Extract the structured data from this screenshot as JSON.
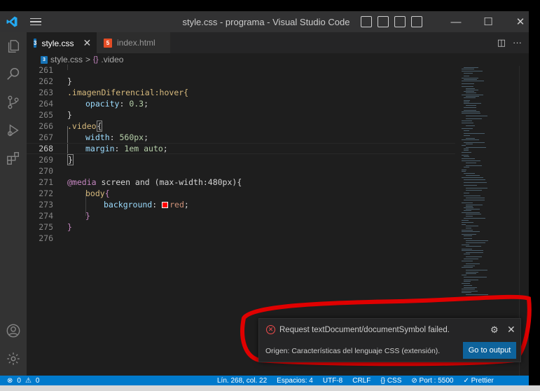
{
  "window": {
    "title": "style.css - programa - Visual Studio Code",
    "controls": {
      "minimize": "—",
      "maximize": "☐",
      "close": "✕"
    }
  },
  "tabs": [
    {
      "label": "style.css",
      "active": true,
      "close": "✕"
    },
    {
      "label": "index.html",
      "active": false
    }
  ],
  "editor_actions": {
    "split": "◫",
    "more": "···"
  },
  "breadcrumb": {
    "file": "style.css",
    "separator": ">",
    "symbol": ".video"
  },
  "code_lines": [
    {
      "n": "261"
    },
    {
      "n": "262"
    },
    {
      "n": "263"
    },
    {
      "n": "264"
    },
    {
      "n": "265"
    },
    {
      "n": "266"
    },
    {
      "n": "267"
    },
    {
      "n": "268"
    },
    {
      "n": "269"
    },
    {
      "n": "270"
    },
    {
      "n": "271"
    },
    {
      "n": "272"
    },
    {
      "n": "273"
    },
    {
      "n": "274"
    },
    {
      "n": "275"
    },
    {
      "n": "276"
    }
  ],
  "code": {
    "l262": "}",
    "l263": ".imagenDiferencial:hover{",
    "l264_prop": "opacity",
    "l264_val": "0.3",
    "l265": "}",
    "l266_sel": ".video",
    "l266_brace": "{",
    "l267_prop": "width",
    "l267_val": "560px",
    "l268_prop": "margin",
    "l268_val": "1em auto",
    "l269": "}",
    "l271_kw": "@media",
    "l271_rest": " screen and (max-width:480px){",
    "l272_sel": "body",
    "l272_brace": "{",
    "l273_prop": "background",
    "l273_val": "red",
    "l274": "}",
    "l275": "}"
  },
  "notification": {
    "message": "Request textDocument/documentSymbol failed.",
    "source": "Origen: Características del lenguaje CSS (extensión).",
    "button": "Go to output",
    "gear": "⚙",
    "close": "✕"
  },
  "statusbar": {
    "errors": "0",
    "warnings": "0",
    "position": "Lín. 268, col. 22",
    "spaces": "Espacios: 4",
    "encoding": "UTF-8",
    "eol": "CRLF",
    "language": "CSS",
    "port": "Port : 5500",
    "prettier": "Prettier"
  },
  "colors": {
    "accent": "#007acc",
    "button": "#0e639c",
    "error": "#f14c4c",
    "annotation": "#e00000"
  }
}
